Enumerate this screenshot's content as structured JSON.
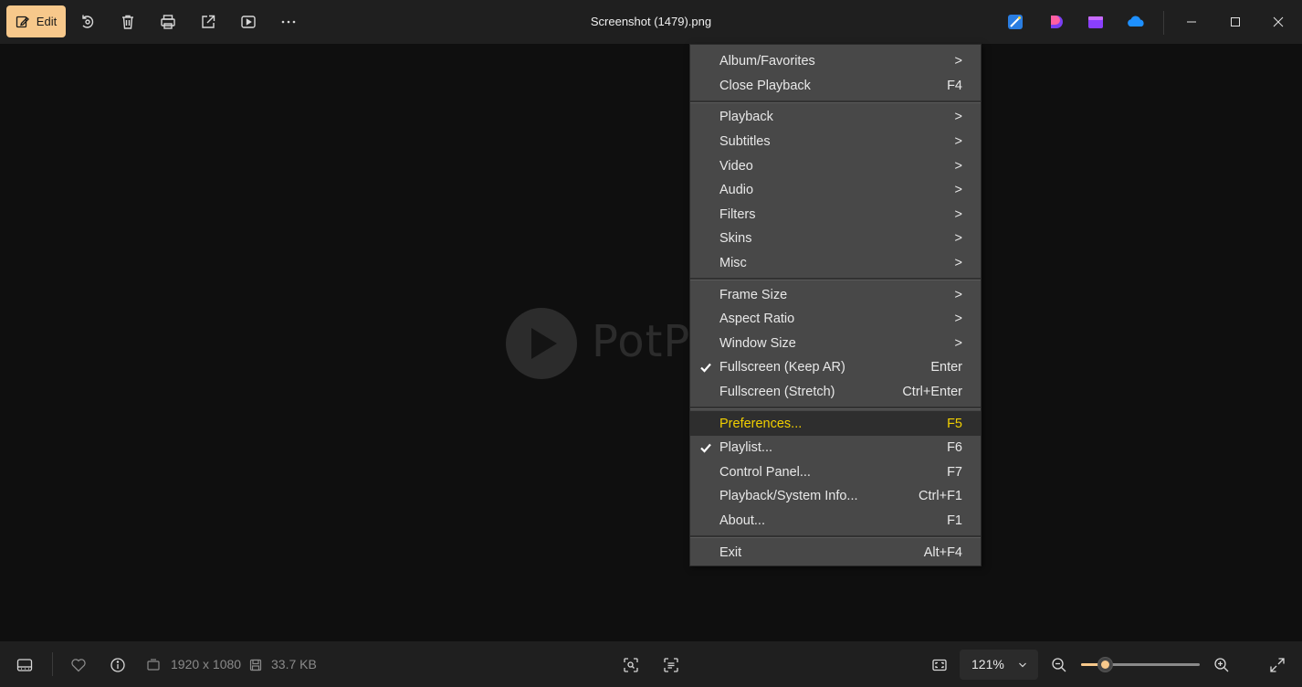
{
  "window": {
    "title": "Screenshot (1479).png",
    "edit_label": "Edit"
  },
  "toolbar_icons": [
    "edit-icon",
    "rotate-icon",
    "delete-icon",
    "print-icon",
    "share-icon",
    "slideshow-icon",
    "more-icon"
  ],
  "app_icons": [
    "designer-icon",
    "clipchamp-icon",
    "video-editor-icon",
    "onedrive-icon"
  ],
  "viewer": {
    "watermark_text": "PotP"
  },
  "menu": {
    "groups": [
      [
        {
          "label": "Album/Favorites",
          "shortcut": ">",
          "checked": false
        },
        {
          "label": "Close Playback",
          "shortcut": "F4",
          "checked": false
        }
      ],
      [
        {
          "label": "Playback",
          "shortcut": ">",
          "checked": false
        },
        {
          "label": "Subtitles",
          "shortcut": ">",
          "checked": false
        },
        {
          "label": "Video",
          "shortcut": ">",
          "checked": false
        },
        {
          "label": "Audio",
          "shortcut": ">",
          "checked": false
        },
        {
          "label": "Filters",
          "shortcut": ">",
          "checked": false
        },
        {
          "label": "Skins",
          "shortcut": ">",
          "checked": false
        },
        {
          "label": "Misc",
          "shortcut": ">",
          "checked": false
        }
      ],
      [
        {
          "label": "Frame Size",
          "shortcut": ">",
          "checked": false
        },
        {
          "label": "Aspect Ratio",
          "shortcut": ">",
          "checked": false
        },
        {
          "label": "Window Size",
          "shortcut": ">",
          "checked": false
        },
        {
          "label": "Fullscreen (Keep AR)",
          "shortcut": "Enter",
          "checked": true
        },
        {
          "label": "Fullscreen (Stretch)",
          "shortcut": "Ctrl+Enter",
          "checked": false
        }
      ],
      [
        {
          "label": "Preferences...",
          "shortcut": "F5",
          "checked": false,
          "highlighted": true
        },
        {
          "label": "Playlist...",
          "shortcut": "F6",
          "checked": true
        },
        {
          "label": "Control Panel...",
          "shortcut": "F7",
          "checked": false
        },
        {
          "label": "Playback/System Info...",
          "shortcut": "Ctrl+F1",
          "checked": false
        },
        {
          "label": "About...",
          "shortcut": "F1",
          "checked": false
        }
      ],
      [
        {
          "label": "Exit",
          "shortcut": "Alt+F4",
          "checked": false
        }
      ]
    ]
  },
  "status": {
    "dimensions": "1920 x 1080",
    "file_size": "33.7 KB",
    "zoom": "121%",
    "zoom_slider_fraction": 0.2
  },
  "colors": {
    "accent": "#f7c88b",
    "highlight_text": "#f2d000",
    "menu_bg": "#484848"
  }
}
